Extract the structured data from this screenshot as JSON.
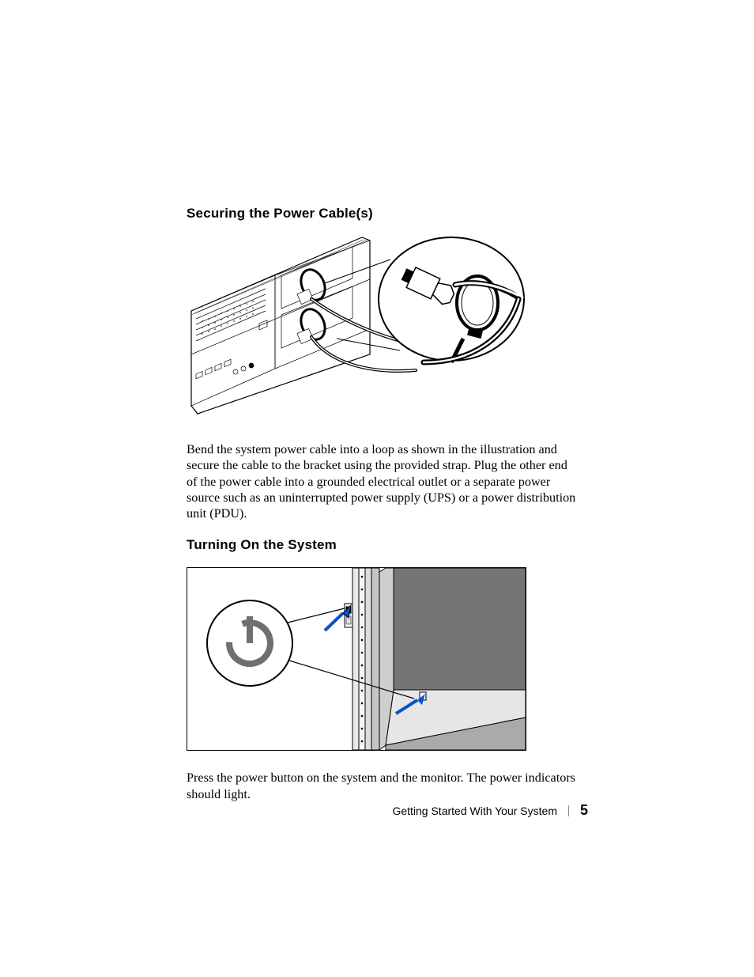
{
  "section1": {
    "heading": "Securing the Power Cable(s)",
    "paragraph": "Bend the system power cable into a loop as shown in the illustration and secure the cable to the bracket using the provided strap. Plug the other end of the power cable into a grounded electrical outlet or a separate power source such as an uninterrupted power supply (UPS) or a power distribution unit (PDU)."
  },
  "section2": {
    "heading": "Turning On the System",
    "paragraph": "Press the power button on the system and the monitor. The power indicators should light."
  },
  "footer": {
    "title": "Getting Started With Your System",
    "page": "5"
  },
  "figures": {
    "fig1_alt": "power-cable-securing-illustration",
    "fig2_alt": "power-button-location-illustration"
  }
}
